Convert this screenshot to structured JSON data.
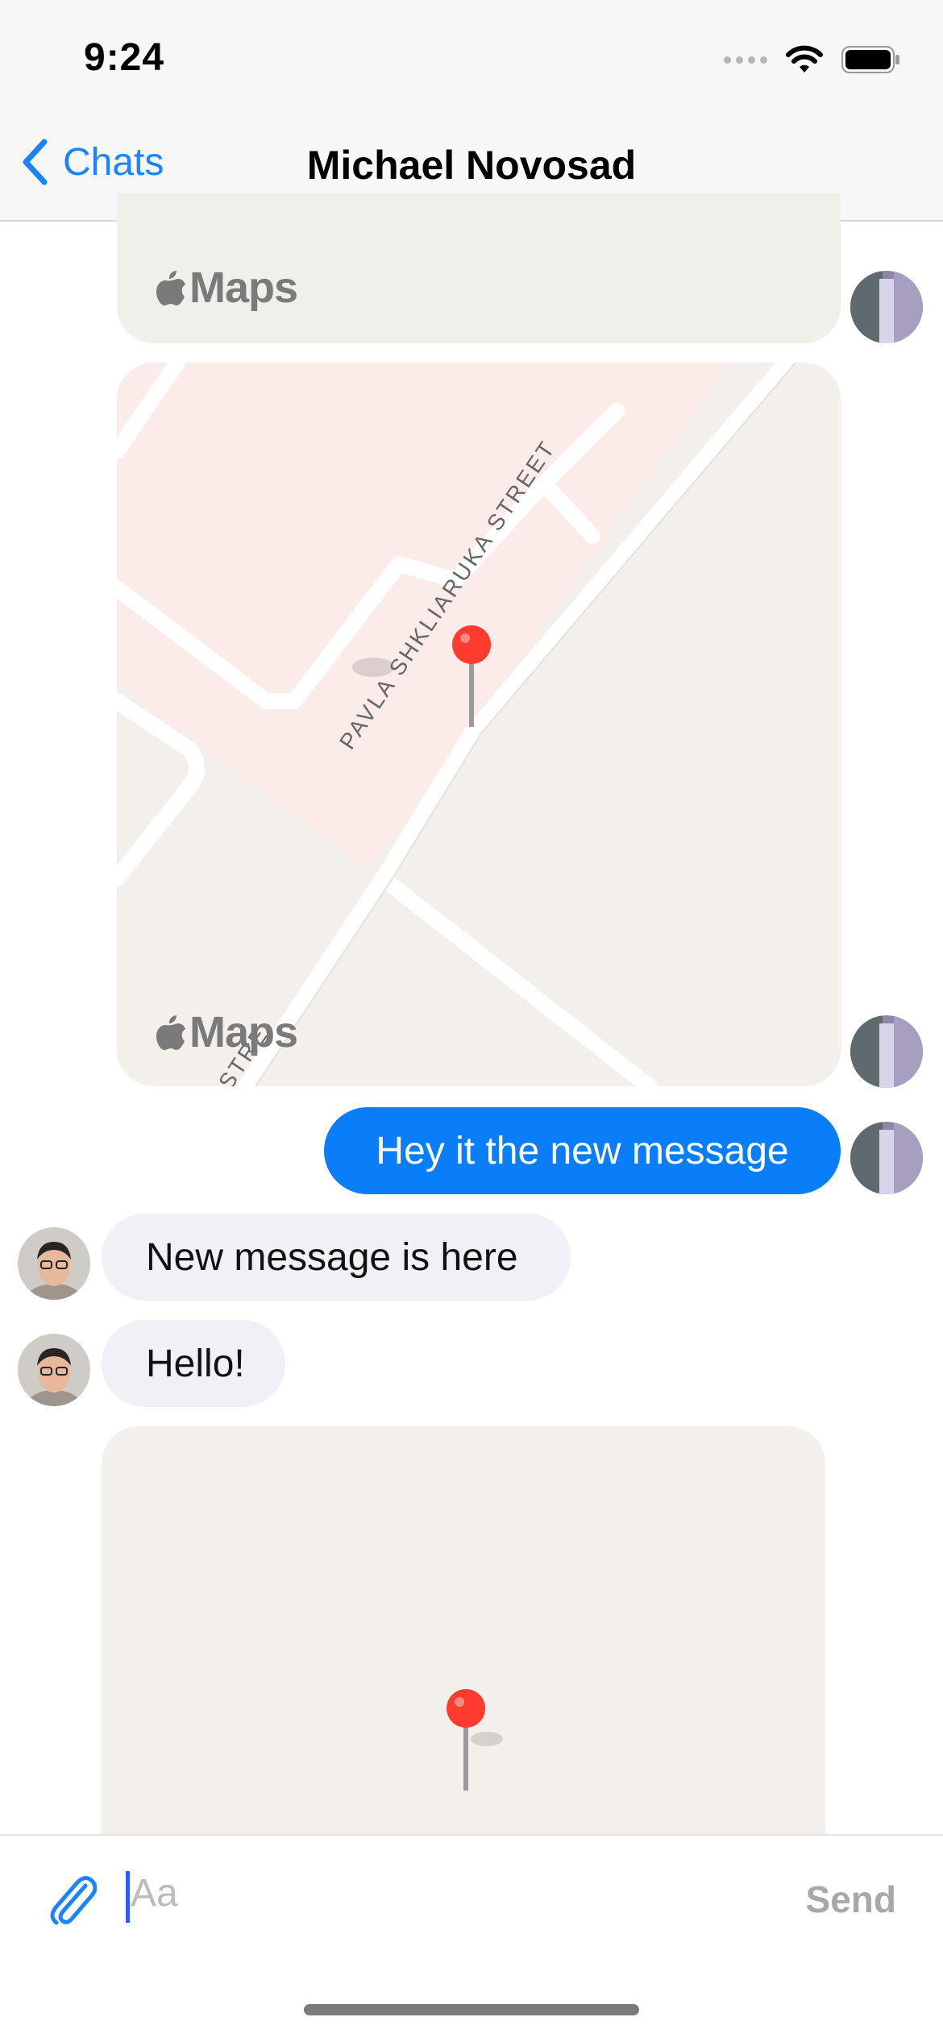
{
  "status_bar": {
    "time": "9:24"
  },
  "nav": {
    "back_label": "Chats",
    "title": "Michael Novosad"
  },
  "messages": {
    "map1_logo": "Maps",
    "map2_logo": "Maps",
    "map2_street": "PAVLA SHKLIARUKA STREET",
    "map2_street_partial": "STRE",
    "outgoing_text": "Hey it the new message",
    "incoming1_text": "New message is here",
    "incoming2_text": "Hello!"
  },
  "composer": {
    "placeholder": "Aa",
    "send_label": "Send"
  },
  "colors": {
    "accent": "#0a7df8",
    "incoming_bubble": "#f0f0f6",
    "map_land": "#f3f0eb",
    "pin": "#ff3b30"
  }
}
